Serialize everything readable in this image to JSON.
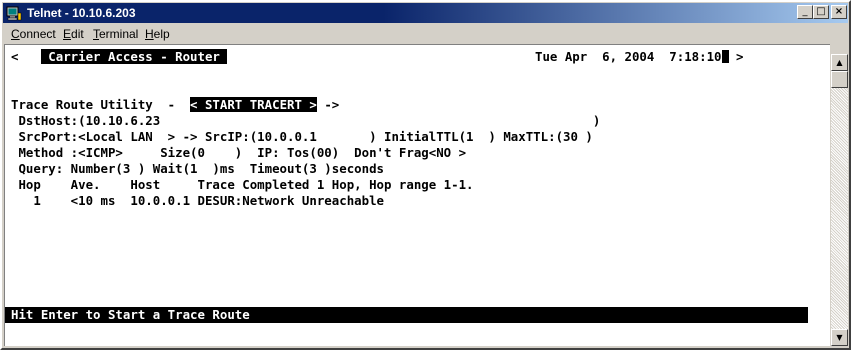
{
  "window": {
    "title": "Telnet - 10.10.6.203",
    "icon": "telnet-app-icon",
    "controls": {
      "minimize": "_",
      "maximize": "□",
      "close": "×"
    }
  },
  "menu": [
    "Connect",
    "Edit",
    "Terminal",
    "Help"
  ],
  "terminal": {
    "header_prefix": "< ",
    "header_title": " Carrier Access - Router ",
    "header_datetime": "Tue Apr  6, 2004  7:18:10",
    "header_suffix": " >",
    "line_trace_prefix": "Trace Route Utility  -  ",
    "line_trace_button": "< START TRACERT >",
    "line_trace_suffix": " ->",
    "line_dsthost": " DstHost:(10.10.6.23                                                          )",
    "line_srcport": " SrcPort:<Local LAN  > -> SrcIP:(10.0.0.1       ) InitialTTL(1  ) MaxTTL:(30 )",
    "line_method": " Method :<ICMP>     Size(0    )  IP: Tos(00)  Don't Frag<NO >",
    "line_query": " Query: Number(3 ) Wait(1  )ms  Timeout(3 )seconds",
    "line_hop_header": " Hop    Ave.    Host     Trace Completed 1 Hop, Hop range 1-1.",
    "line_hop_row": "   1    <10 ms  10.0.0.1 DESUR:Network Unreachable",
    "status": "Hit Enter to Start a Trace Route"
  },
  "scrollbar": {
    "up": "▲",
    "down": "▼"
  }
}
